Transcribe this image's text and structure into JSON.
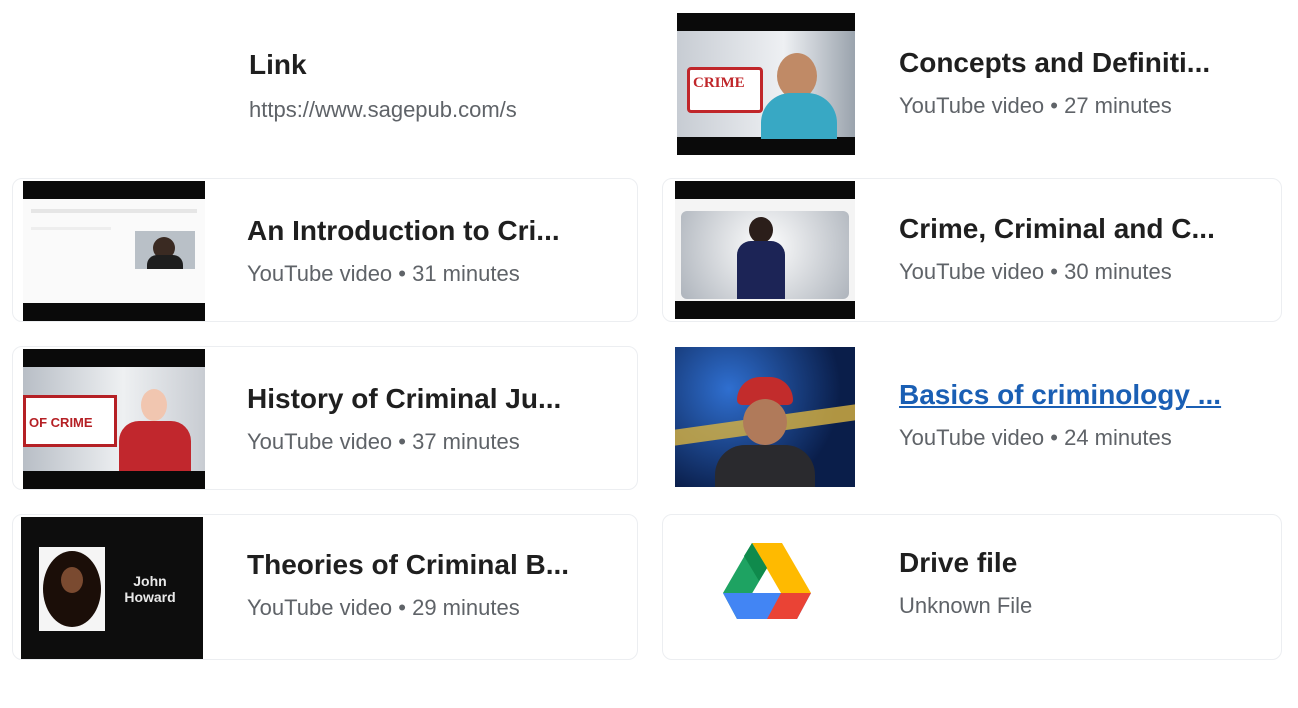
{
  "attachments": [
    {
      "kind": "link",
      "title": "Link",
      "subtitle": "https://www.sagepub.com/s"
    },
    {
      "kind": "video",
      "title": "Concepts and Definiti...",
      "subtitle": "YouTube video • 27 minutes",
      "thumb_text": "CRIME"
    },
    {
      "kind": "video",
      "title": "An Introduction to Cri...",
      "subtitle": "YouTube video • 31 minutes"
    },
    {
      "kind": "video",
      "title": "Crime, Criminal and C...",
      "subtitle": "YouTube video • 30 minutes"
    },
    {
      "kind": "video",
      "title": "History of Criminal Ju...",
      "subtitle": "YouTube video • 37 minutes",
      "thumb_text": "OF CRIME"
    },
    {
      "kind": "video",
      "title": "Basics of criminology ...",
      "subtitle": "YouTube video • 24 minutes",
      "hovered": true
    },
    {
      "kind": "video",
      "title": "Theories of Criminal B...",
      "subtitle": "YouTube video • 29 minutes",
      "thumb_text": "John Howard"
    },
    {
      "kind": "drive",
      "title": "Drive file",
      "subtitle": "Unknown File",
      "icon": "google-drive-icon"
    }
  ],
  "colors": {
    "link": "#1a5fb4",
    "subtitle": "#5f6368",
    "drive_green": "#1ea362",
    "drive_yellow": "#ffba00",
    "drive_blue": "#4285f4",
    "drive_red": "#ea4335"
  }
}
